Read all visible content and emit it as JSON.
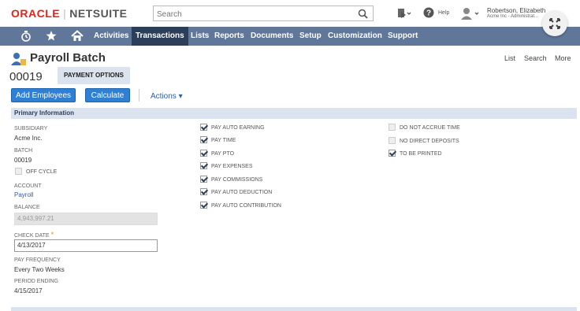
{
  "header": {
    "logo_oracle": "ORACLE",
    "logo_sep": "|",
    "logo_netsuite": "NETSUITE",
    "search_placeholder": "Search",
    "help_label": "Help",
    "user_name": "Robertson, Elizabeth",
    "user_sub": "Acme Inc - Administrat..."
  },
  "nav": {
    "items": [
      "Activities",
      "Transactions",
      "Lists",
      "Reports",
      "Documents",
      "Setup",
      "Customization",
      "Support"
    ],
    "active": "Transactions"
  },
  "page": {
    "title": "Payroll Batch",
    "links": [
      "List",
      "Search",
      "More"
    ],
    "record_number": "00019",
    "tab_label": "PAYMENT OPTIONS"
  },
  "buttons": {
    "add_employees": "Add Employees",
    "calculate": "Calculate",
    "actions": "Actions ▾"
  },
  "section": {
    "title": "Primary Information"
  },
  "fields": {
    "subsidiary_label": "SUBSIDIARY",
    "subsidiary_value": "Acme Inc.",
    "batch_label": "BATCH",
    "batch_value": "00019",
    "off_cycle_label": "OFF CYCLE",
    "account_label": "ACCOUNT",
    "account_value": "Payroll",
    "balance_label": "BALANCE",
    "balance_value": "4,943,997.21",
    "check_date_label": "CHECK DATE",
    "check_date_value": "4/13/2017",
    "pay_frequency_label": "PAY FREQUENCY",
    "pay_frequency_value": "Every Two Weeks",
    "period_ending_label": "PERIOD ENDING",
    "period_ending_value": "4/15/2017"
  },
  "checkboxes_col2": [
    {
      "label": "PAY AUTO EARNING",
      "checked": true
    },
    {
      "label": "PAY TIME",
      "checked": true
    },
    {
      "label": "PAY PTO",
      "checked": true
    },
    {
      "label": "PAY EXPENSES",
      "checked": true
    },
    {
      "label": "PAY COMMISSIONS",
      "checked": true
    },
    {
      "label": "PAY AUTO DEDUCTION",
      "checked": true
    },
    {
      "label": "PAY AUTO CONTRIBUTION",
      "checked": true
    }
  ],
  "checkboxes_col3": [
    {
      "label": "DO NOT ACCRUE TIME",
      "checked": false
    },
    {
      "label": "NO DIRECT DEPOSITS",
      "checked": false
    },
    {
      "label": "TO BE PRINTED",
      "checked": true
    }
  ],
  "colors": {
    "nav_bg": "#607799",
    "nav_active": "#2d3e5a",
    "button_blue": "#2f7fd2",
    "section_bg": "#dbe3ee",
    "oracle_red": "#e2231a"
  }
}
